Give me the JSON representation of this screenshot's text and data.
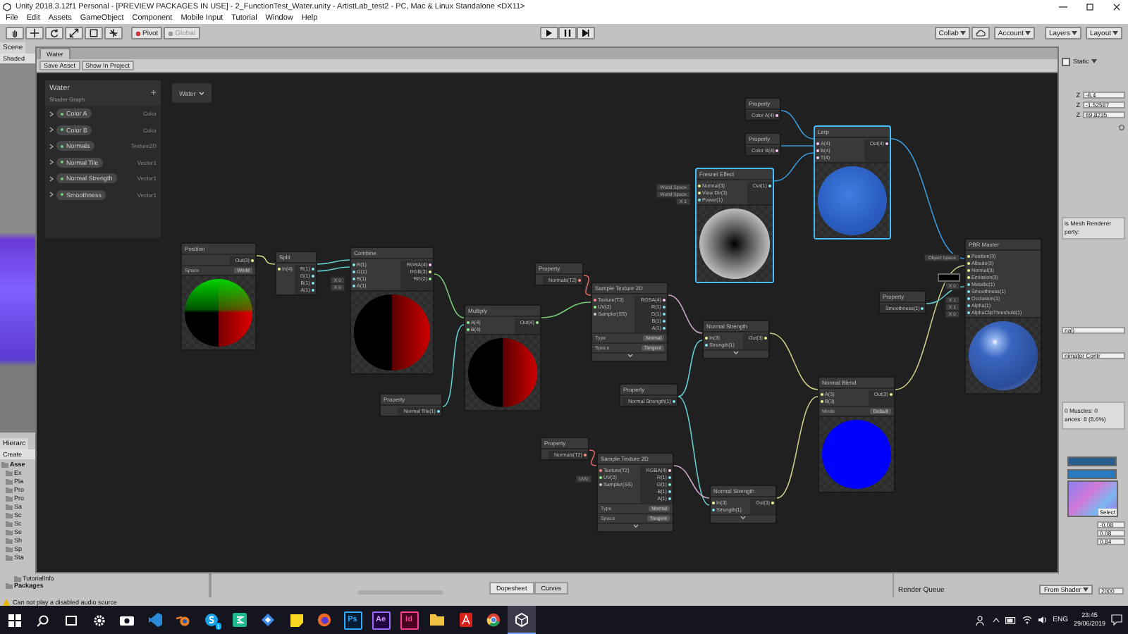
{
  "window": {
    "title": "Unity 2018.3.12f1 Personal - [PREVIEW PACKAGES IN USE] - 2_FunctionTest_Water.unity - ArtistLab_test2 - PC, Mac & Linux Standalone <DX11>"
  },
  "menu": [
    "File",
    "Edit",
    "Assets",
    "GameObject",
    "Component",
    "Mobile Input",
    "Tutorial",
    "Window",
    "Help"
  ],
  "toolbar": {
    "pivot": "Pivot",
    "global": "Global",
    "collab": "Collab",
    "account": "Account",
    "layers": "Layers",
    "layout": "Layout"
  },
  "scene_panel": {
    "tab": "Scene",
    "shading": "Shaded"
  },
  "project_panel": {
    "tab": "Hierarc",
    "create": "Create",
    "items": [
      "Asse",
      "Ex",
      "Pla",
      "Pro",
      "Pro",
      "Sa",
      "Sc",
      "Sc",
      "Se",
      "Sh",
      "Sp",
      "Sta"
    ],
    "bottom_items": [
      "TutorialInfo",
      "Packages"
    ]
  },
  "shader_window": {
    "tab": "Water",
    "buttons": [
      "Save Asset",
      "Show In Project"
    ],
    "graph_dropdown": "Water",
    "blackboard": {
      "title": "Water",
      "subtitle": "Shader Graph",
      "add": "+",
      "properties": [
        {
          "name": "Color A",
          "type": "Color"
        },
        {
          "name": "Color B",
          "type": "Color"
        },
        {
          "name": "Normals",
          "type": "Texture2D"
        },
        {
          "name": "Normal Tile",
          "type": "Vector1"
        },
        {
          "name": "Normal Strength",
          "type": "Vector1"
        },
        {
          "name": "Smoothness",
          "type": "Vector1"
        }
      ]
    },
    "nodes": [
      {
        "title": "Position",
        "kind": "position",
        "selected": false,
        "outputs": [
          {
            "label": "Out(3)",
            "color": "#f6ff9a"
          }
        ],
        "fields": [
          {
            "label": "Space",
            "value": "World"
          }
        ]
      },
      {
        "title": "Split",
        "kind": "plain",
        "selected": false,
        "inputs": [
          {
            "label": "In(4)",
            "color": "#f6ff9a"
          }
        ],
        "outputs": [
          {
            "label": "R(1)",
            "color": "#84e4e7"
          },
          {
            "label": "G(1)",
            "color": "#84e4e7"
          },
          {
            "label": "B(1)",
            "color": "#84e4e7"
          },
          {
            "label": "A(1)",
            "color": "#84e4e7"
          }
        ]
      },
      {
        "title": "Combine",
        "kind": "split",
        "selected": false,
        "inputs": [
          {
            "label": "R(1)",
            "color": "#84e4e7"
          },
          {
            "label": "G(1)",
            "color": "#84e4e7"
          },
          {
            "label": "B(1)",
            "color": "#84e4e7",
            "default": "X 0"
          },
          {
            "label": "A(1)",
            "color": "#84e4e7",
            "default": "X 0"
          }
        ],
        "outputs": [
          {
            "label": "RGBA(4)",
            "color": "#fbcbf4"
          },
          {
            "label": "RGB(3)",
            "color": "#f6ff9a"
          },
          {
            "label": "RG(2)",
            "color": "#9aef92"
          }
        ]
      },
      {
        "title": "Property",
        "kind": "plain",
        "selected": false,
        "outputs": [
          {
            "label": "Normal Tile(1)",
            "color": "#84e4e7"
          }
        ]
      },
      {
        "title": "Multiply",
        "kind": "split",
        "selected": false,
        "inputs": [
          {
            "label": "A(4)",
            "color": "#9aef92"
          },
          {
            "label": "B(4)",
            "color": "#9aef92"
          }
        ],
        "outputs": [
          {
            "label": "Out(4)",
            "color": "#9aef92"
          }
        ]
      },
      {
        "title": "Property",
        "kind": "plain",
        "selected": false,
        "outputs": [
          {
            "label": "Normals(T2)",
            "color": "#ff8b8b"
          }
        ]
      },
      {
        "title": "Sample Texture 2D",
        "kind": "collapsed",
        "selected": false,
        "inputs": [
          {
            "label": "Texture(T2)",
            "color": "#ff8b8b"
          },
          {
            "label": "UV(2)",
            "color": "#9aef92"
          },
          {
            "label": "Sampler(SS)",
            "color": "#cccccc"
          }
        ],
        "outputs": [
          {
            "label": "RGBA(4)",
            "color": "#fbcbf4"
          },
          {
            "label": "R(1)",
            "color": "#84e4e7"
          },
          {
            "label": "G(1)",
            "color": "#84e4e7"
          },
          {
            "label": "B(1)",
            "color": "#84e4e7"
          },
          {
            "label": "A(1)",
            "color": "#84e4e7"
          }
        ],
        "fields": [
          {
            "label": "Type",
            "value": "Normal"
          },
          {
            "label": "Space",
            "value": "Tangent"
          }
        ]
      },
      {
        "title": "Property",
        "kind": "plain",
        "selected": false,
        "outputs": [
          {
            "label": "Color A(4)",
            "color": "#fbcbf4"
          }
        ]
      },
      {
        "title": "Property",
        "kind": "plain",
        "selected": false,
        "outputs": [
          {
            "label": "Color B(4)",
            "color": "#fbcbf4"
          }
        ]
      },
      {
        "title": "Fresnel Effect",
        "kind": "radial",
        "selected": true,
        "inputs": [
          {
            "label": "Normal(3)",
            "color": "#f6ff9a",
            "default": "World Space"
          },
          {
            "label": "View Dir(3)",
            "color": "#f6ff9a",
            "default": "World Space"
          },
          {
            "label": "Power(1)",
            "color": "#84e4e7",
            "default": "X 1"
          }
        ],
        "outputs": [
          {
            "label": "Out(1)",
            "color": "#84e4e7"
          }
        ]
      },
      {
        "title": "Lerp",
        "kind": "sphere",
        "selected": true,
        "inputs": [
          {
            "label": "A(4)",
            "color": "#fbcbf4"
          },
          {
            "label": "B(4)",
            "color": "#fbcbf4"
          },
          {
            "label": "T(4)",
            "color": "#fbcbf4"
          }
        ],
        "outputs": [
          {
            "label": "Out(4)",
            "color": "#fbcbf4"
          }
        ]
      },
      {
        "title": "Normal Strength",
        "kind": "collapsed",
        "selected": false,
        "inputs": [
          {
            "label": "In(3)",
            "color": "#f6ff9a"
          },
          {
            "label": "Strength(1)",
            "color": "#84e4e7"
          }
        ],
        "outputs": [
          {
            "label": "Out(3)",
            "color": "#f6ff9a"
          }
        ]
      },
      {
        "title": "Property",
        "kind": "plain",
        "selected": false,
        "outputs": [
          {
            "label": "Normal Strength(1)",
            "color": "#84e4e7"
          }
        ]
      },
      {
        "title": "Normal Blend",
        "kind": "circle",
        "selected": false,
        "inputs": [
          {
            "label": "A(3)",
            "color": "#f6ff9a"
          },
          {
            "label": "B(3)",
            "color": "#f6ff9a"
          }
        ],
        "outputs": [
          {
            "label": "Out(3)",
            "color": "#f6ff9a"
          }
        ],
        "fields": [
          {
            "label": "Mode",
            "value": "Default"
          }
        ]
      },
      {
        "title": "Property",
        "kind": "plain",
        "selected": false,
        "outputs": [
          {
            "label": "Normals(T2)",
            "color": "#ff8b8b"
          }
        ]
      },
      {
        "title": "Sample Texture 2D",
        "kind": "collapsed",
        "selected": false,
        "inputs": [
          {
            "label": "Texture(T2)",
            "color": "#ff8b8b"
          },
          {
            "label": "UV(2)",
            "color": "#9aef92",
            "default": "UV0"
          },
          {
            "label": "Sampler(SS)",
            "color": "#cccccc"
          }
        ],
        "outputs": [
          {
            "label": "RGBA(4)",
            "color": "#fbcbf4"
          },
          {
            "label": "R(1)",
            "color": "#84e4e7"
          },
          {
            "label": "G(1)",
            "color": "#84e4e7"
          },
          {
            "label": "B(1)",
            "color": "#84e4e7"
          },
          {
            "label": "A(1)",
            "color": "#84e4e7"
          }
        ],
        "fields": [
          {
            "label": "Type",
            "value": "Normal"
          },
          {
            "label": "Space",
            "value": "Tangent"
          }
        ]
      },
      {
        "title": "Normal Strength",
        "kind": "collapsed",
        "selected": false,
        "inputs": [
          {
            "label": "In(3)",
            "color": "#f6ff9a"
          },
          {
            "label": "Strength(1)",
            "color": "#84e4e7"
          }
        ],
        "outputs": [
          {
            "label": "Out(3)",
            "color": "#f6ff9a"
          }
        ]
      },
      {
        "title": "Property",
        "kind": "plain",
        "selected": false,
        "outputs": [
          {
            "label": "Smoothness(1)",
            "color": "#84e4e7"
          }
        ]
      },
      {
        "title": "PBR Master",
        "kind": "shaded_sphere",
        "selected": false,
        "inputs": [
          {
            "label": "Position(3)",
            "color": "#f6ff9a",
            "default": "Object Space"
          },
          {
            "label": "Albedo(3)",
            "color": "#f6ff9a"
          },
          {
            "label": "Normal(3)",
            "color": "#f6ff9a"
          },
          {
            "label": "Emission(3)",
            "color": "#f6ff9a",
            "swatch": true
          },
          {
            "label": "Metallic(1)",
            "color": "#84e4e7",
            "default": "X 0"
          },
          {
            "label": "Smoothness(1)",
            "color": "#84e4e7"
          },
          {
            "label": "Occlusion(1)",
            "color": "#84e4e7",
            "default": "X 1"
          },
          {
            "label": "Alpha(1)",
            "color": "#84e4e7",
            "default": "X 1"
          },
          {
            "label": "AlphaClipThreshold(1)",
            "color": "#84e4e7",
            "default": "X 0"
          }
        ]
      }
    ]
  },
  "inspector": {
    "static": {
      "label": "Static",
      "checked": false
    },
    "position": [
      {
        "axis": "Z",
        "value": "-6.4"
      },
      {
        "axis": "Z",
        "value": "-1.52587"
      },
      {
        "axis": "Z",
        "value": "69.8235"
      }
    ],
    "help_lines": [
      "is Mesh Renderer",
      "perty:"
    ],
    "material_field": "nal)",
    "controller_field": "nimator Contr",
    "stats": [
      "0 Muscles: 0",
      "ances: 8 (8.6%)"
    ],
    "texture_button": "Select",
    "values": [
      "-0.08",
      "0.08",
      "0.84"
    ],
    "render_queue": {
      "label": "Render Queue",
      "mode": "From Shader",
      "value": "2000"
    }
  },
  "timeline_tabs": [
    "Dopesheet",
    "Curves"
  ],
  "status_bar": "Can not play a disabled audio source",
  "taskbar": {
    "apps": [
      {
        "kind": "start",
        "active": false
      },
      {
        "kind": "search",
        "active": false
      },
      {
        "kind": "taskview",
        "active": false
      },
      {
        "kind": "settings",
        "active": false
      },
      {
        "kind": "camera",
        "active": false
      },
      {
        "kind": "code",
        "active": false
      },
      {
        "kind": "blender",
        "active": false
      },
      {
        "kind": "skype",
        "active": false,
        "badge": "1"
      },
      {
        "kind": "green",
        "active": false
      },
      {
        "kind": "bluebird",
        "active": false
      },
      {
        "kind": "sticky",
        "active": false
      },
      {
        "kind": "firefox",
        "active": false
      },
      {
        "kind": "letter",
        "label": "Ps",
        "active": false
      },
      {
        "kind": "letter_purple",
        "label": "Ae",
        "active": false
      },
      {
        "kind": "letter_pink",
        "label": "Id",
        "active": false
      },
      {
        "kind": "folder",
        "active": false
      },
      {
        "kind": "acrobat",
        "active": false
      },
      {
        "kind": "chrome",
        "active": false
      },
      {
        "kind": "unity",
        "active": true
      }
    ],
    "language": "ENG",
    "time": "23:45",
    "date": "29/06/2019"
  }
}
